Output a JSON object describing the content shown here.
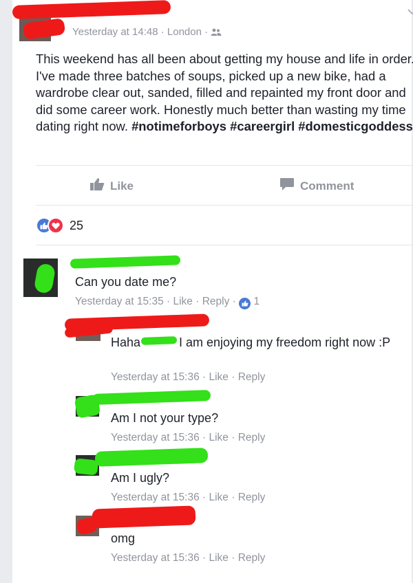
{
  "post": {
    "timestamp": "Yesterday at 14:48",
    "location": "London",
    "separator": "·",
    "text": "This weekend has all been about getting my house and life in order. I've made three batches of soups, picked up a new bike, had a wardrobe clear out, sanded, filled and repainted my front door and did some career work. Honestly much better than wasting my time dating right now.",
    "hashtags": "#notimeforboys #careergirl #domesticgoddess"
  },
  "actions": {
    "like_label": "Like",
    "comment_label": "Comment"
  },
  "reactions": {
    "count": "25"
  },
  "comments": [
    {
      "text": "Can you date me?",
      "time": "Yesterday at 15:35",
      "like": "Like",
      "reply": "Reply",
      "likes": "1"
    },
    {
      "text_start": "Haha",
      "text_end": "I am enjoying my freedom right now :P",
      "time": "Yesterday at 15:36",
      "like": "Like",
      "reply": "Reply"
    },
    {
      "text": "Am I not your type?",
      "time": "Yesterday at 15:36",
      "like": "Like",
      "reply": "Reply"
    },
    {
      "text": "Am I ugly?",
      "time": "Yesterday at 15:36",
      "like": "Like",
      "reply": "Reply"
    },
    {
      "text": "omg",
      "time": "Yesterday at 15:36",
      "like": "Like",
      "reply": "Reply"
    }
  ],
  "icons": {
    "chevron": "chevron-down-icon",
    "audience": "friends-icon",
    "like": "thumbs-up-icon",
    "comment": "speech-bubble-icon",
    "love": "heart-icon"
  },
  "colors": {
    "link_blue": "#4b7ad5",
    "love_red": "#f0334b",
    "meta_gray": "#90949c",
    "redaction_red": "#ee1a1a",
    "redaction_green": "#33e019"
  }
}
